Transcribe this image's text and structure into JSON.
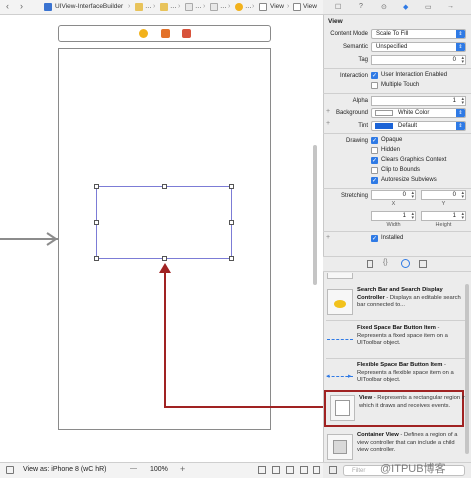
{
  "jumpbar": {
    "project": "UIView-InterfaceBuilder",
    "crumb_last_a": "View",
    "crumb_last_b": "View",
    "nav_back": "‹",
    "nav_forward": "›",
    "ellipsis_a": "…",
    "ellipsis_b": "…",
    "ellipsis_c": "…",
    "ellipsis_d": "…"
  },
  "inspector_tabs": [
    "☐",
    "?",
    "⊙",
    "◆",
    "▭",
    "→"
  ],
  "inspector": {
    "section_title": "View",
    "content_mode_label": "Content Mode",
    "content_mode_value": "Scale To Fill",
    "semantic_label": "Semantic",
    "semantic_value": "Unspecified",
    "tag_label": "Tag",
    "tag_value": "0",
    "interaction_label": "Interaction",
    "user_interaction": "User Interaction Enabled",
    "multiple_touch": "Multiple Touch",
    "alpha_label": "Alpha",
    "alpha_value": "1",
    "background_label": "Background",
    "background_value": "White Color",
    "tint_label": "Tint",
    "tint_value": "Default",
    "drawing_label": "Drawing",
    "opaque": "Opaque",
    "hidden": "Hidden",
    "clears_graphics": "Clears Graphics Context",
    "clip_bounds": "Clip to Bounds",
    "autoresize": "Autoresize Subviews",
    "stretching_label": "Stretching",
    "stretch_x": "0",
    "stretch_y": "0",
    "stretch_w": "1",
    "stretch_h": "1",
    "x_label": "X",
    "y_label": "Y",
    "width_label": "Width",
    "height_label": "Height",
    "installed": "Installed"
  },
  "library": {
    "items": [
      {
        "title": "Search Bar and Search Display Controller",
        "desc": "Displays an editable search bar connected to..."
      },
      {
        "title": "Fixed Space Bar Button Item",
        "desc": "Represents a fixed space item on a UIToolbar object."
      },
      {
        "title": "Flexible Space Bar Button Item",
        "desc": "Represents a flexible space item on a UIToolbar object."
      },
      {
        "title": "View",
        "desc": "Represents a rectangular region in which it draws and receives events."
      },
      {
        "title": "Container View",
        "desc": "Defines a region of a view controller that can include a child view controller."
      }
    ],
    "filter_placeholder": "Filter"
  },
  "bottombar": {
    "view_as": "View as: iPhone 8 (wC hR)",
    "zoom_minus": "—",
    "zoom": "100%",
    "zoom_plus": "+"
  },
  "watermark": "@ITPUB博客",
  "colors": {
    "accent": "#2f7ae5",
    "highlight": "#a02222",
    "selection": "#7c7cd6"
  }
}
